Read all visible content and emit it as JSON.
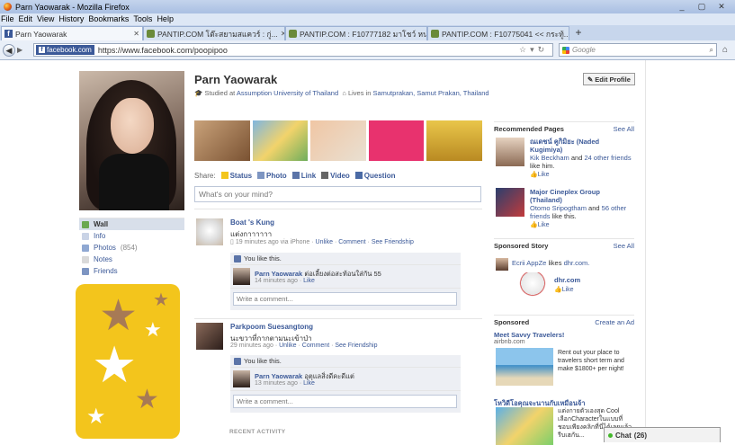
{
  "window": {
    "title": "Parn Yaowarak - Mozilla Firefox",
    "controls": [
      "_",
      "▢",
      "✕"
    ]
  },
  "menu": [
    "File",
    "Edit",
    "View",
    "History",
    "Bookmarks",
    "Tools",
    "Help"
  ],
  "tabs": [
    {
      "label": "Parn Yaowarak",
      "active": true
    },
    {
      "label": "PANTIP.COM โต๊ะสยามสแควร์ : กู่..."
    },
    {
      "label": "PANTIP.COM : F10777182 มาโชว์ หน..."
    },
    {
      "label": "PANTIP.COM : F10775041 << กระทู้..."
    }
  ],
  "newtab_label": "+",
  "nav": {
    "site_identity": "facebook.com",
    "url": "https://www.facebook.com/poopipoo",
    "search_placeholder": "Google"
  },
  "profile": {
    "name": "Parn Yaowarak",
    "studied_prefix": "Studied at",
    "school": "Assumption University of Thailand",
    "lives_prefix": "Lives in",
    "location": "Samutprakan, Samut Prakan, Thailand",
    "edit_label": "Edit Profile"
  },
  "leftnav": [
    {
      "label": "Wall",
      "active": true
    },
    {
      "label": "Info"
    },
    {
      "label": "Photos",
      "count": "(854)"
    },
    {
      "label": "Notes"
    },
    {
      "label": "Friends"
    }
  ],
  "share": {
    "label": "Share:",
    "options": [
      "Status",
      "Photo",
      "Link",
      "Video",
      "Question"
    ],
    "placeholder": "What's on your mind?"
  },
  "posts": [
    {
      "author": "Boat 's Kung",
      "text": "แต่งกาาาาาา",
      "time": "19 minutes ago via iPhone",
      "actions": [
        "Unlike",
        "Comment",
        "See Friendship"
      ],
      "likes": "You like this.",
      "comment": {
        "author": "Parn Yaowarak",
        "text": "ต่อเลี้ยงต่อสะท้อนใส่กัน 55",
        "time": "14 minutes ago",
        "action": "Like"
      },
      "write": "Write a comment..."
    },
    {
      "author": "Parkpoom Suesangtong",
      "text": "นะขวาที่กากตามนะเข้าป่า",
      "time": "29 minutes ago",
      "actions": [
        "Unlike",
        "Comment",
        "See Friendship"
      ],
      "likes": "You like this.",
      "comment": {
        "author": "Parn Yaowarak",
        "text": "อุตุแลสิ่งดีคะดีแต่",
        "time": "13 minutes ago",
        "action": "Like"
      },
      "write": "Write a comment..."
    }
  ],
  "recent_activity": "RECENT ACTIVITY",
  "right": {
    "recommended": {
      "title": "Recommended Pages",
      "see_all": "See All",
      "items": [
        {
          "name": "ณเดชน์ คูกิมิยะ (Naded Kugimiya)",
          "friend": "Kik Beckham",
          "rest_mid": "and",
          "others": "24 other friends",
          "tail": "like him.",
          "like": "Like"
        },
        {
          "name": "Major Cineplex Group (Thailand)",
          "friend": "Otomo Sripogtham",
          "rest_mid": "and",
          "others": "56 other friends",
          "tail": "like this.",
          "like": "Like"
        }
      ]
    },
    "sponsored_story": {
      "title": "Sponsored Story",
      "see_all": "See All",
      "actor": "Ecrii AppZe",
      "verb": "likes",
      "page": "dhr.com.",
      "page_name": "dhr.com",
      "like": "Like"
    },
    "sponsored": {
      "title": "Sponsored",
      "create": "Create an Ad",
      "ads": [
        {
          "title": "Meet Savvy Travelers!",
          "source": "airbnb.com",
          "text": "Rent out your place to travelers short term and make $1800+ per night!"
        },
        {
          "title": "โหวิดีโอคุณจะนานกับเหมือนจ้า",
          "source": "",
          "text": "แต่งกายตัวเองสุด Cool เลือกCharacterในแบบที่ชอบเพียงคลิกที่นี่ได้เลยแล้วรีบเฮกัน..."
        }
      ]
    }
  },
  "chat": {
    "label": "Chat",
    "count": "(26)"
  },
  "colors": {
    "facebook_blue": "#3b5998",
    "star_bg": "#f3c51c",
    "star_brown": "#a77a55"
  }
}
